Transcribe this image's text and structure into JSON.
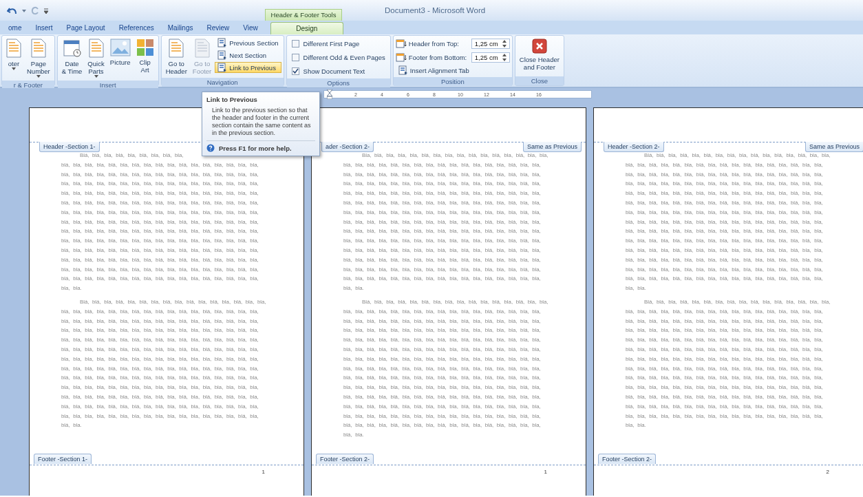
{
  "window": {
    "title": "Document3 - Microsoft Word",
    "context_tab": "Header & Footer Tools"
  },
  "tabs": [
    {
      "label": "ome",
      "selected": false
    },
    {
      "label": "Insert",
      "selected": false
    },
    {
      "label": "Page Layout",
      "selected": false
    },
    {
      "label": "References",
      "selected": false
    },
    {
      "label": "Mailings",
      "selected": false
    },
    {
      "label": "Review",
      "selected": false
    },
    {
      "label": "View",
      "selected": false
    },
    {
      "label": "Design",
      "selected": true
    }
  ],
  "ribbon_groups": [
    {
      "label": "r & Footer",
      "items": [
        {
          "kind": "large",
          "lines": [
            "oter"
          ],
          "dropdown": true,
          "disabled": false
        },
        {
          "kind": "large",
          "lines": [
            "Page",
            "Number"
          ],
          "dropdown": true,
          "disabled": false
        }
      ]
    },
    {
      "label": "Insert",
      "items": [
        {
          "kind": "large",
          "lines": [
            "Date",
            "& Time"
          ],
          "dropdown": false,
          "disabled": false
        },
        {
          "kind": "large",
          "lines": [
            "Quick",
            "Parts"
          ],
          "dropdown": true,
          "disabled": false
        },
        {
          "kind": "large",
          "lines": [
            "Picture"
          ],
          "dropdown": false,
          "disabled": false
        },
        {
          "kind": "large",
          "lines": [
            "Clip",
            "Art"
          ],
          "dropdown": false,
          "disabled": false
        }
      ]
    },
    {
      "label": "Navigation",
      "items": [
        {
          "kind": "large",
          "lines": [
            "Go to",
            "Header"
          ],
          "dropdown": false,
          "disabled": false
        },
        {
          "kind": "large",
          "lines": [
            "Go to",
            "Footer"
          ],
          "dropdown": false,
          "disabled": true
        },
        {
          "kind": "small",
          "label": "Previous Section",
          "highlighted": false
        },
        {
          "kind": "small",
          "label": "Next Section",
          "highlighted": false
        },
        {
          "kind": "small",
          "label": "Link to Previous",
          "highlighted": true
        }
      ]
    },
    {
      "label": "Options",
      "items": [
        {
          "kind": "checkbox",
          "label": "Different First Page",
          "checked": false
        },
        {
          "kind": "checkbox",
          "label": "Different Odd & Even Pages",
          "checked": false
        },
        {
          "kind": "checkbox",
          "label": "Show Document Text",
          "checked": true
        }
      ]
    },
    {
      "label": "Position",
      "items": [
        {
          "kind": "spin",
          "label": "Header from Top:",
          "value": "1,25 cm"
        },
        {
          "kind": "spin",
          "label": "Footer from Bottom:",
          "value": "1,25 cm"
        },
        {
          "kind": "small",
          "label": "Insert Alignment Tab",
          "highlighted": false
        }
      ]
    },
    {
      "label": "Close",
      "items": [
        {
          "kind": "close",
          "lines": [
            "Close Header",
            "and Footer"
          ]
        }
      ]
    }
  ],
  "ruler": {
    "labels": [
      "2",
      "4",
      "6",
      "8",
      "10",
      "12",
      "14",
      "16"
    ]
  },
  "tooltip": {
    "title": "Link to Previous",
    "body": "Link to the previous section so that the header and footer in the current section contain the same content as in the previous section.",
    "help": "Press F1 for more help."
  },
  "pages": [
    {
      "header_label": "Header -Section 1-",
      "paragraphs": [
        [
          "Blá, blá, bla, blá, bla, blá, bla, blá, bla,",
          "blá, bla, blá, bla, blá, bla, blá, bla, blá, bla, blá, bla, blá, bla, blá, bla, bla,",
          "blá, bla, blá, bla, blá, bla, blá, bla, blá, bla, blá, bla, blá, bla, blá, bla, bla,",
          "bla, bla, bla, bla, bla, bla, bla, bla, bla, bla, bla, bla, bla, bla, bla, blá, bla,",
          "blá, bla, blá, bla, blá, bla, blá, bla, blá, bla, blá, bla, blá, bla, blá, bla, bla,",
          "blá, bla, blá, bla, blá, bla, blá, bla, blá, bla, blá, bla, blá, bla, blá, bla, bla,",
          "bla, bla, bla, bla, bla, bla, bla, bla, bla, bla, bla, bla, bla, bla, bla, blá, bla,",
          "blá, bla, blá, bla, blá, bla, blá, bla, blá, bla, blá, bla, blá, bla, blá, bla, bla,",
          "blá, bla, blá, bla, blá, bla, blá, bla, blá, bla, blá, bla, blá, bla, blá, bla, bla,",
          "bla, bla, bla, bla, bla, bla, bla, bla, bla, bla, bla, bla, bla, bla, bla, blá, bla,",
          "blá, bla, blá, bla, blá, bla, blá, bla, blá, bla, blá, bla, blá, bla, blá, bla, bla,",
          "blá, bla, blá, bla, blá, bla, blá, bla, blá, bla, blá, bla, blá, bla, blá, bla, bla,",
          "bla, bla, bla, bla, bla, bla, bla, bla, bla, bla, bla, bla, bla, bla, bla, blá, bla,",
          "blá, bla, blá, bla, blá, bla, blá, bla, blá, bla, blá, bla, blá, bla, blá, bla, bla,",
          "bla, bla."
        ],
        [
          "Blá, blá, bla, blá, bla, blá, bla, blá, bla, blá, bla, blá, bla, blá, bla, bla,",
          "blá, bla, blá, bla, blá, bla, blá, bla, blá, bla, blá, bla, blá, bla, blá, bla, bla,",
          "blá, bla, blá, bla, blá, bla, blá, bla, blá, bla, blá, bla, blá, bla, blá, bla, bla,",
          "bla, bla, bla, bla, bla, bla, bla, bla, bla, bla, bla, bla, bla, bla, bla, blá, bla,",
          "blá, bla, blá, bla, blá, bla, blá, bla, blá, bla, blá, bla, blá, bla, blá, bla, bla,",
          "blá, bla, blá, bla, blá, bla, blá, bla, blá, bla, blá, bla, blá, bla, blá, bla, bla,",
          "bla, bla, bla, bla, bla, bla, bla, bla, bla, bla, bla, bla, bla, bla, bla, blá, bla,",
          "blá, bla, blá, bla, blá, bla, blá, bla, blá, bla, blá, bla, blá, bla, blá, bla, bla,",
          "blá, bla, blá, bla, blá, bla, blá, bla, blá, bla, blá, bla, blá, bla, blá, bla, bla,",
          "bla, bla, bla, bla, bla, bla, bla, bla, bla, bla, bla, bla, bla, bla, bla, blá, bla,",
          "blá, bla, blá, bla, blá, bla, blá, bla, blá, bla, blá, bla, blá, bla, blá, bla, bla,",
          "blá, bla, blá, bla, blá, bla, blá, bla, blá, bla, blá, bla, blá, bla, blá, bla, bla,",
          "bla, bla, bla, bla, bla, bla, bla, bla, bla, bla, bla, bla, bla, bla, bla, blá, bla,",
          "blá, bla."
        ]
      ],
      "footer_label": "Footer -Section 1-",
      "page_number": "1"
    },
    {
      "header_label": "ader -Section 2-",
      "header_note": "Same as Previous",
      "paragraphs": [
        [
          "Bla, blá, bla, bla, bla, blá, bla, bla, bla, blá, bla, blá, bla, blá, bla, bla,",
          "blá, bla, blá, bla, blá, bla, blá, bla, blá, bla, blá, bla, blá, bla, blá, bla, bla,",
          "blá, bla, blá, bla, blá, bla, blá, bla, blá, bla, blá, bla, blá, bla, blá, bla, bla,",
          "bla, bla, bla, bla, bla, bla, bla, bla, bla, bla, bla, bla, bla, bla, bla, blá, bla,",
          "blá, bla, blá, bla, blá, bla, blá, bla, blá, bla, blá, bla, blá, bla, blá, bla, bla,",
          "blá, bla, blá, bla, blá, bla, blá, bla, blá, bla, blá, bla, blá, bla, blá, bla, bla,",
          "bla, bla, bla, bla, bla, bla, bla, bla, bla, bla, bla, bla, bla, bla, bla, blá, bla,",
          "blá, bla, blá, bla, blá, bla, blá, bla, blá, bla, blá, bla, blá, bla, blá, bla, bla,",
          "blá, bla, blá, bla, blá, bla, blá, bla, blá, bla, blá, bla, blá, bla, blá, bla, bla,",
          "bla, bla, bla, bla, bla, bla, bla, bla, bla, bla, bla, bla, bla, bla, bla, blá, bla,",
          "blá, bla, blá, bla, blá, bla, blá, bla, blá, bla, blá, bla, blá, bla, blá, bla, bla,",
          "blá, bla, blá, bla, blá, bla, blá, bla, blá, bla, blá, bla, blá, bla, blá, bla, bla,",
          "bla, bla, bla, bla, bla, bla, bla, bla, bla, bla, bla, bla, bla, bla, bla, blá, bla,",
          "blá, bla, blá, bla, blá, bla, blá, bla, blá, bla, blá, bla, blá, bla, blá, bla, bla,",
          "blá, bla."
        ],
        [
          "Blá, blá, bla, blá, bla, blá, bla, blá, bla, blá, bla, blá, bla, blá, bla, bla,",
          "blá, bla, blá, bla, blá, bla, blá, bla, blá, bla, blá, bla, blá, bla, blá, bla, bla,",
          "blá, bla, blá, bla, blá, bla, blá, bla, blá, bla, blá, bla, blá, bla, blá, bla, bla,",
          "bla, bla, bla, bla, bla, bla, bla, bla, bla, bla, bla, bla, bla, bla, bla, blá, bla,",
          "blá, bla, blá, bla, blá, bla, blá, bla, blá, bla, blá, bla, blá, bla, blá, bla, bla,",
          "blá, bla, blá, bla, blá, bla, blá, bla, blá, bla, blá, bla, blá, bla, blá, bla, bla,",
          "bla, bla, bla, bla, bla, bla, bla, bla, bla, bla, bla, bla, bla, bla, bla, blá, bla,",
          "blá, bla, blá, bla, blá, bla, blá, bla, blá, bla, blá, bla, blá, bla, blá, bla, bla,",
          "blá, bla, blá, bla, blá, bla, blá, bla, blá, bla, blá, bla, blá, bla, blá, bla, bla,",
          "bla, bla, bla, bla, bla, bla, bla, bla, bla, bla, bla, bla, bla, bla, bla, blá, bla,",
          "blá, bla, blá, bla, blá, bla, blá, bla, blá, bla, blá, bla, blá, bla, blá, bla, bla,",
          "blá, bla, blá, bla, blá, bla, blá, bla, blá, bla, blá, bla, blá, bla, blá, bla, bla,",
          "bla, bla, bla, bla, bla, bla, bla, bla, bla, bla, bla, bla, bla, bla, bla, blá, bla,",
          "blá, bla, blá, bla, blá, bla, blá, bla, blá, bla, blá, bla, blá, bla, blá, bla, bla,",
          "blá, bla."
        ]
      ],
      "footer_label": "Footer -Section 2-",
      "page_number": "1"
    },
    {
      "header_label": "Header -Section 2-",
      "header_note": "Same as Previous",
      "paragraphs": [
        [
          "Blá, blá, bla, blá, bla, blá, bla, blá, bla, blá, bla, blá, bla, blá, bla, bla,",
          "blá, bla, blá, bla, blá, bla, blá, bla, blá, bla, blá, bla, blá, bla, blá, bla, bla,",
          "blá, bla, blá, bla, blá, bla, blá, bla, blá, bla, blá, bla, blá, bla, blá, bla, bla,",
          "bla, bla, bla, bla, bla, bla, bla, bla, bla, bla, bla, bla, bla, bla, bla, blá, bla,",
          "blá, bla, blá, bla, blá, bla, blá, bla, blá, bla, blá, bla, blá, bla, blá, bla, bla,",
          "blá, bla, blá, bla, blá, bla, blá, bla, blá, bla, blá, bla, blá, bla, blá, bla, bla,",
          "bla, bla, bla, bla, bla, bla, bla, bla, bla, bla, bla, bla, bla, bla, bla, blá, bla,",
          "blá, bla, blá, bla, blá, bla, blá, bla, blá, bla, blá, bla, blá, bla, blá, bla, bla,",
          "blá, bla, blá, bla, blá, bla, blá, bla, blá, bla, blá, bla, blá, bla, blá, bla, bla,",
          "bla, bla, bla, bla, bla, bla, bla, bla, bla, bla, bla, bla, bla, bla, bla, blá, bla,",
          "blá, bla, blá, bla, blá, bla, blá, bla, blá, bla, blá, bla, blá, bla, blá, bla, bla,",
          "blá, bla, blá, bla, blá, bla, blá, bla, blá, bla, blá, bla, blá, bla, blá, bla, bla,",
          "bla, bla, bla, bla, bla, bla, bla, bla, bla, bla, bla, bla, bla, bla, bla, blá, bla,",
          "blá, bla, blá, bla, blá, bla, blá, bla, blá, bla, blá, bla, blá, bla, blá, bla, bla,",
          "bla, bla."
        ],
        [
          "Blá, blá, bla, blá, bla, blá, bla, blá, bla, blá, bla, blá, bla, blá, bla, bla,",
          "blá, bla, blá, bla, blá, bla, blá, bla, blá, bla, blá, bla, blá, bla, blá, bla, bla,",
          "blá, bla, blá, bla, blá, bla, blá, bla, blá, bla, blá, bla, blá, bla, blá, bla, bla,",
          "bla, bla, bla, bla, bla, bla, bla, bla, bla, bla, bla, bla, bla, bla, bla, blá, bla,",
          "blá, bla, blá, bla, blá, bla, blá, bla, blá, bla, blá, bla, blá, bla, blá, bla, bla,",
          "blá, bla, blá, bla, blá, bla, blá, bla, blá, bla, blá, bla, blá, bla, blá, bla, bla,",
          "bla, bla, bla, bla, bla, bla, bla, bla, bla, bla, bla, bla, bla, bla, bla, blá, bla,",
          "blá, bla, blá, bla, blá, bla, blá, bla, blá, bla, blá, bla, blá, bla, blá, bla, bla,",
          "blá, bla, blá, bla, blá, bla, blá, bla, blá, bla, blá, bla, blá, bla, blá, bla, bla,",
          "bla, bla, bla, bla, bla, bla, bla, bla, bla, bla, bla, bla, bla, bla, bla, blá, bla,",
          "blá, bla, blá, bla, blá, bla, blá, bla, blá, bla, blá, bla, blá, bla, blá, bla, bla,",
          "blá, bla, blá, bla, blá, bla, blá, bla, blá, bla, blá, bla, blá, bla, blá, bla, bla,",
          "bla, bla, bla, bla, bla, bla, bla, bla, bla, bla, bla, bla, bla, bla, bla, blá, bla,",
          "bla, bla."
        ]
      ],
      "footer_label": "Footer -Section 2-",
      "page_number": "2"
    }
  ]
}
